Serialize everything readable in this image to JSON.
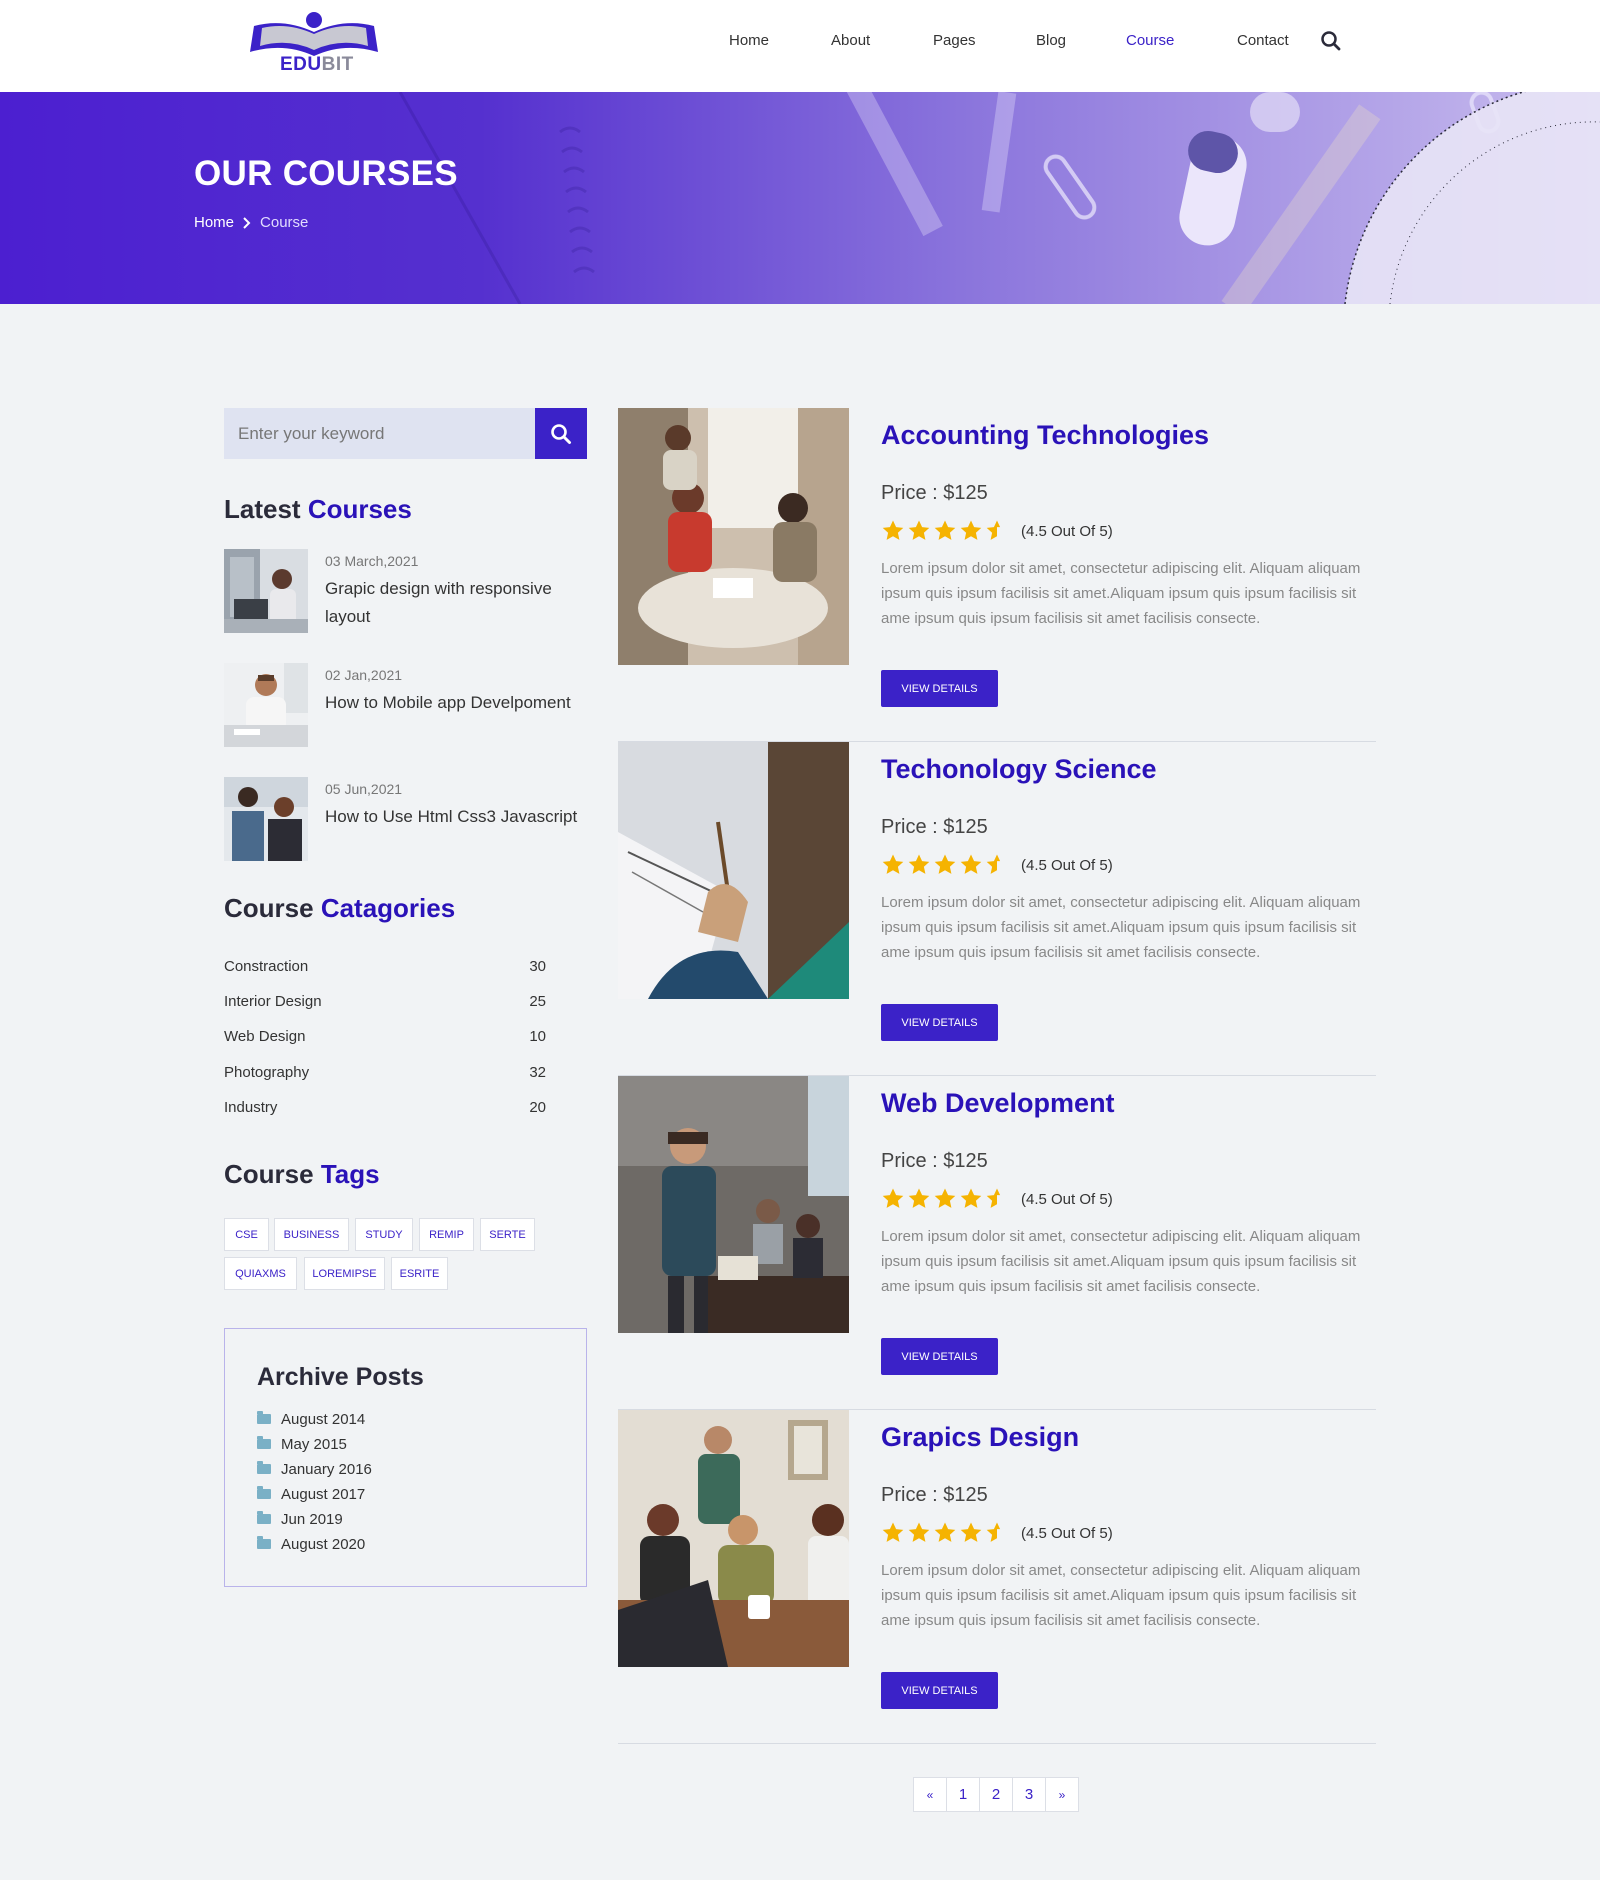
{
  "brand": {
    "name_a": "EDU",
    "name_b": "BIT"
  },
  "nav": {
    "items": [
      {
        "label": "Home"
      },
      {
        "label": "About"
      },
      {
        "label": "Pages"
      },
      {
        "label": "Blog"
      },
      {
        "label": "Course"
      },
      {
        "label": "Contact"
      }
    ],
    "active": "Course"
  },
  "banner": {
    "title": "OUR COURSES",
    "breadcrumb": {
      "home": "Home",
      "current": "Course"
    }
  },
  "sidebar": {
    "search": {
      "placeholder": "Enter your keyword"
    },
    "latest": {
      "heading_a": "Latest",
      "heading_b": "Courses",
      "items": [
        {
          "date": "03 March,2021",
          "title": "Grapic design with responsive layout"
        },
        {
          "date": "02 Jan,2021",
          "title": "How to Mobile app Develpoment"
        },
        {
          "date": "05 Jun,2021",
          "title": "How to Use Html Css3 Javascript"
        }
      ]
    },
    "categories": {
      "heading_a": "Course",
      "heading_b": "Catagories",
      "items": [
        {
          "name": "Constraction",
          "count": "30"
        },
        {
          "name": "Interior Design",
          "count": "25"
        },
        {
          "name": "Web Design",
          "count": "10"
        },
        {
          "name": "Photography",
          "count": "32"
        },
        {
          "name": "Industry",
          "count": "20"
        }
      ]
    },
    "tags": {
      "heading_a": "Course",
      "heading_b": "Tags",
      "items": [
        "CSE",
        "BUSINESS",
        "STUDY",
        "REMIP",
        "SERTE",
        "QUIAXMS",
        "LOREMIPSE",
        "ESRITE"
      ]
    },
    "archive": {
      "title": "Archive Posts",
      "items": [
        "August 2014",
        "May 2015",
        "January 2016",
        "August 2017",
        "Jun 2019",
        "August 2020"
      ]
    }
  },
  "courses": [
    {
      "title": "Accounting Technologies",
      "price": "Price : $125",
      "rating": 4.5,
      "rating_text": "(4.5 Out Of 5)",
      "description": "Lorem ipsum dolor sit amet, consectetur adipiscing elit. Aliquam aliquam ipsum quis ipsum facilisis sit amet.Aliquam ipsum quis ipsum facilisis sit ame ipsum quis ipsum facilisis sit amet facilisis consecte.",
      "button": "VIEW DETAILS"
    },
    {
      "title": "Techonology Science",
      "price": "Price : $125",
      "rating": 4.5,
      "rating_text": "(4.5 Out Of 5)",
      "description": "Lorem ipsum dolor sit amet, consectetur adipiscing elit. Aliquam aliquam ipsum quis ipsum facilisis sit amet.Aliquam ipsum quis ipsum facilisis sit ame ipsum quis ipsum facilisis sit amet facilisis consecte.",
      "button": "VIEW DETAILS"
    },
    {
      "title": "Web Development",
      "price": "Price : $125",
      "rating": 4.5,
      "rating_text": "(4.5 Out Of 5)",
      "description": "Lorem ipsum dolor sit amet, consectetur adipiscing elit. Aliquam aliquam ipsum quis ipsum facilisis sit amet.Aliquam ipsum quis ipsum facilisis sit ame ipsum quis ipsum facilisis sit amet facilisis consecte.",
      "button": "VIEW DETAILS"
    },
    {
      "title": "Grapics Design",
      "price": "Price : $125",
      "rating": 4.5,
      "rating_text": "(4.5 Out Of 5)",
      "description": "Lorem ipsum dolor sit amet, consectetur adipiscing elit. Aliquam aliquam ipsum quis ipsum facilisis sit amet.Aliquam ipsum quis ipsum facilisis sit ame ipsum quis ipsum facilisis sit amet facilisis consecte.",
      "button": "VIEW DETAILS"
    }
  ],
  "pagination": {
    "prev": "«",
    "pages": [
      "1",
      "2",
      "3"
    ],
    "next": "»"
  },
  "icons": {
    "search": "search-icon",
    "chevron": "chevron-right-icon",
    "star": "star-icon",
    "folder": "folder-icon"
  },
  "colors": {
    "brand": "#3b22c8",
    "heading_accent": "#2a12b8",
    "star": "#f5b301",
    "background": "#f1f3f5"
  }
}
